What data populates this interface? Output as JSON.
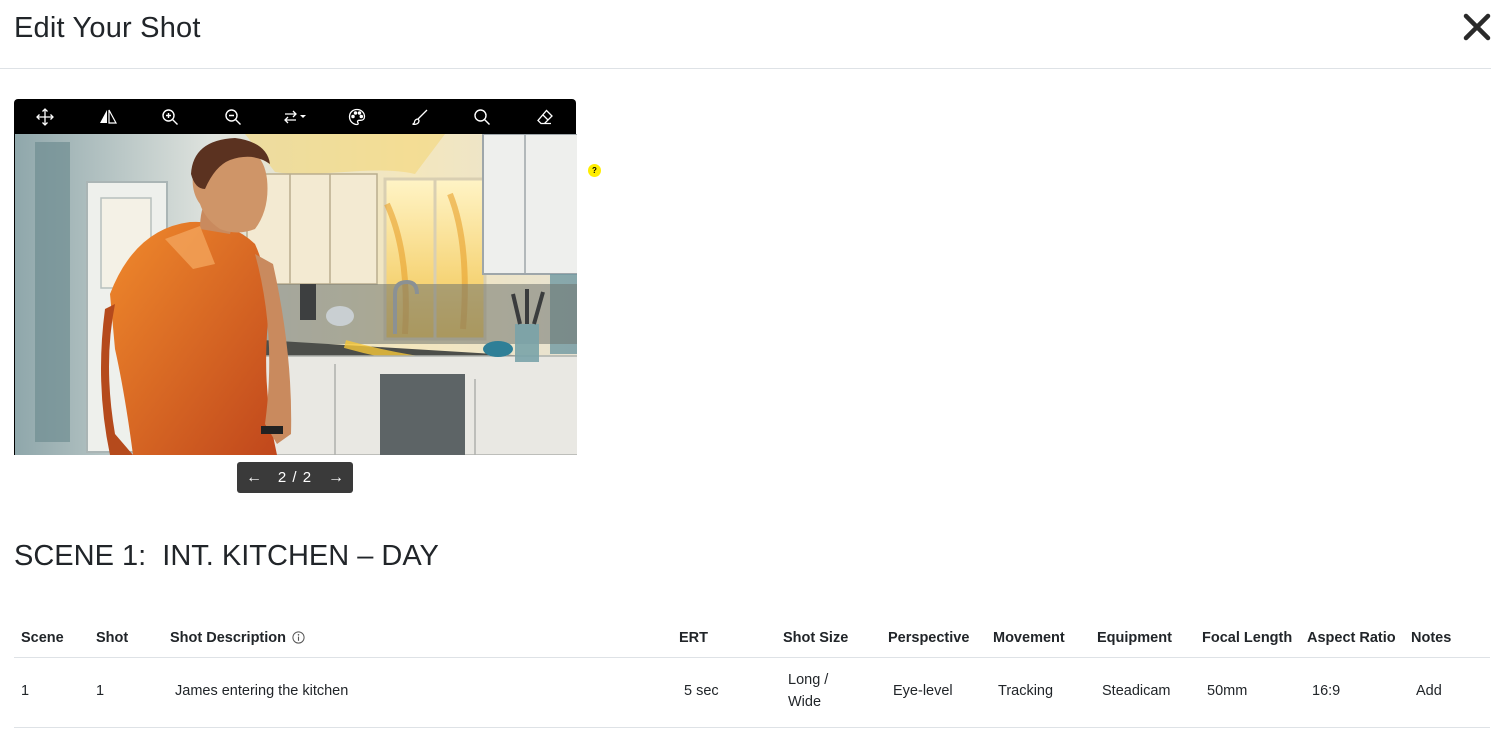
{
  "modal": {
    "title": "Edit Your Shot",
    "close_icon": "close-icon"
  },
  "toolbar": {
    "tools": [
      {
        "name": "move-icon"
      },
      {
        "name": "flip-icon"
      },
      {
        "name": "zoom-in-icon"
      },
      {
        "name": "zoom-out-icon"
      },
      {
        "name": "swap-arrows-icon"
      },
      {
        "name": "palette-icon"
      },
      {
        "name": "brush-icon"
      },
      {
        "name": "search-icon"
      },
      {
        "name": "eraser-icon"
      }
    ]
  },
  "pager": {
    "prev_label": "←",
    "count": "2 / 2",
    "next_label": "→"
  },
  "help": {
    "label": "?",
    "color": "#ffee00"
  },
  "scene": {
    "heading": "SCENE 1:  INT. KITCHEN – DAY"
  },
  "table": {
    "headers": [
      "Scene",
      "Shot",
      "Shot Description",
      "ERT",
      "Shot Size",
      "Perspective",
      "Movement",
      "Equipment",
      "Focal Length",
      "Aspect Ratio",
      "Notes"
    ],
    "rows": [
      {
        "scene": "1",
        "shot": "1",
        "description": "James entering the kitchen",
        "ert": "5 sec",
        "shot_size_line1": "Long /",
        "shot_size_line2": "Wide",
        "perspective": "Eye-level",
        "movement": "Tracking",
        "equipment": "Steadicam",
        "focal_length": "50mm",
        "aspect_ratio": "16:9",
        "notes": "Add"
      }
    ]
  }
}
